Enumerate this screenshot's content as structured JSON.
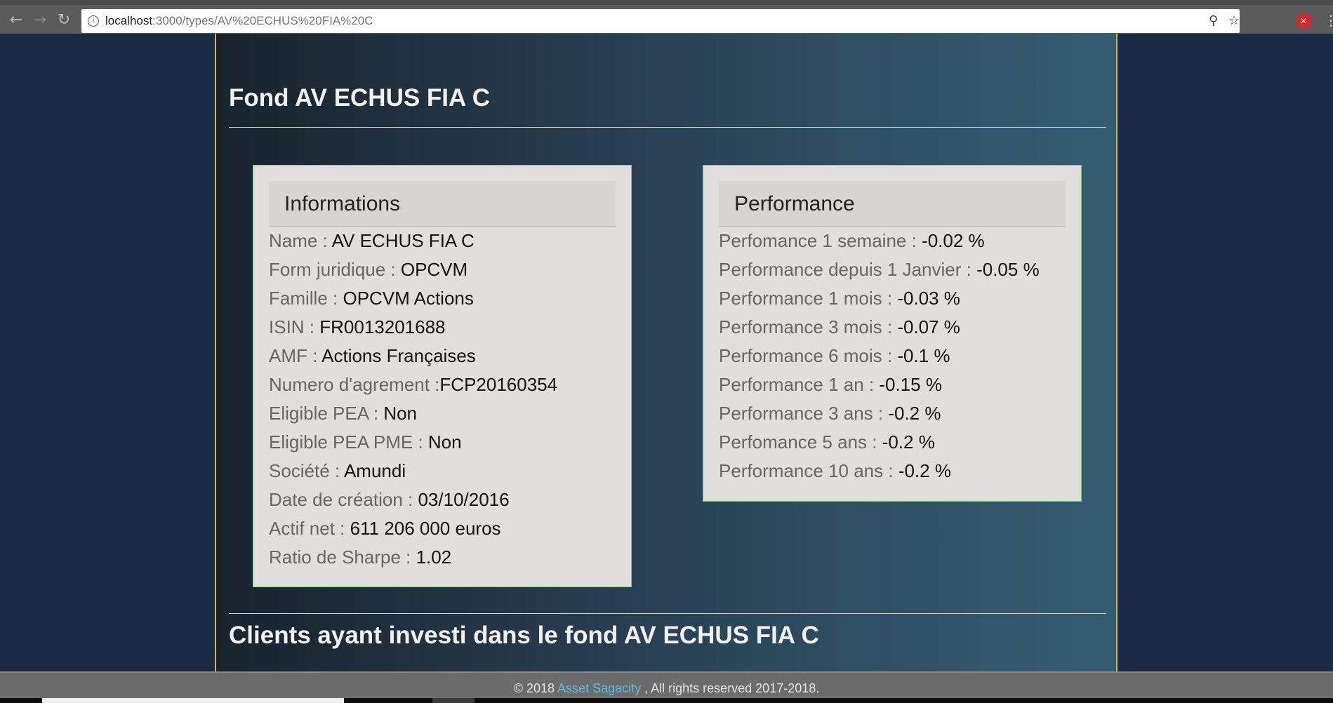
{
  "browser": {
    "url_host": "localhost",
    "url_path": ":3000/types/AV%20ECHUS%20FIA%20C",
    "back_icon": "arrow-left-icon",
    "forward_icon": "arrow-right-icon",
    "reload_icon": "reload-icon"
  },
  "page": {
    "title": "Fond AV ECHUS FIA C",
    "clients_title": "Clients ayant investi dans le fond AV ECHUS FIA C"
  },
  "informations": {
    "heading": "Informations",
    "rows": [
      {
        "label": "Name : ",
        "value": "AV ECHUS FIA C"
      },
      {
        "label": "Form juridique : ",
        "value": "OPCVM"
      },
      {
        "label": "Famille : ",
        "value": "OPCVM Actions"
      },
      {
        "label": "ISIN : ",
        "value": "FR0013201688"
      },
      {
        "label": "AMF : ",
        "value": "Actions Françaises"
      },
      {
        "label": "Numero d'agrement :",
        "value": "FCP20160354"
      },
      {
        "label": "Eligible PEA : ",
        "value": "Non"
      },
      {
        "label": "Eligible PEA PME : ",
        "value": "Non"
      },
      {
        "label": "Société : ",
        "value": "Amundi"
      },
      {
        "label": "Date de création : ",
        "value": "03/10/2016"
      },
      {
        "label": "Actif net : ",
        "value": "611 206 000 euros"
      },
      {
        "label": "Ratio de Sharpe : ",
        "value": "1.02"
      }
    ]
  },
  "performance": {
    "heading": "Performance",
    "rows": [
      {
        "label": "Perfomance 1 semaine : ",
        "value": "-0.02 %"
      },
      {
        "label": "Performance depuis 1 Janvier : ",
        "value": "-0.05 %"
      },
      {
        "label": "Performance 1 mois : ",
        "value": "-0.03 %"
      },
      {
        "label": "Performance 3 mois : ",
        "value": "-0.07 %"
      },
      {
        "label": "Performance 6 mois : ",
        "value": "-0.1 %"
      },
      {
        "label": "Performance 1 an : ",
        "value": "-0.15 %"
      },
      {
        "label": "Performance 3 ans : ",
        "value": "-0.2 %"
      },
      {
        "label": "Perfomance 5 ans : ",
        "value": "-0.2 %"
      },
      {
        "label": "Performance 10 ans : ",
        "value": "-0.2 %"
      }
    ]
  },
  "footer": {
    "prefix": "© 2018 ",
    "link": "Asset Sagacity",
    "suffix": " , All rights reserved 2017-2018."
  }
}
